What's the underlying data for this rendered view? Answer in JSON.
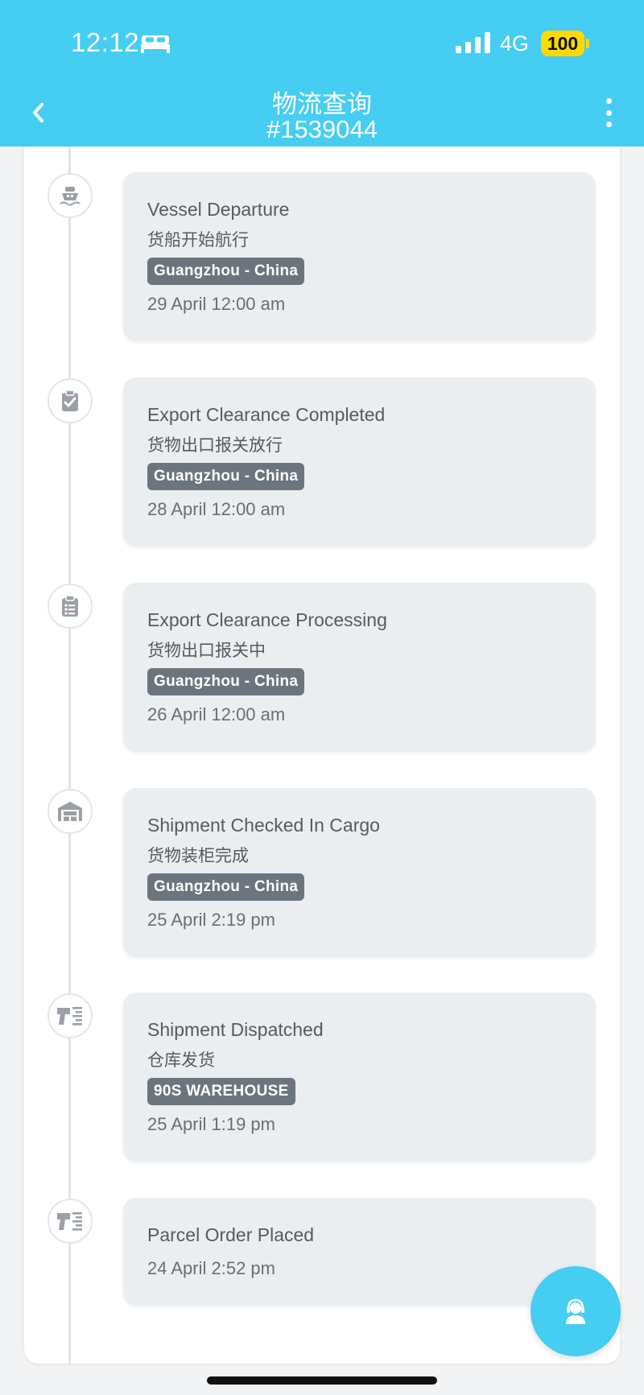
{
  "status_bar": {
    "time": "12:12",
    "network": "4G",
    "battery": "100"
  },
  "header": {
    "title": "物流查询",
    "order_number": "#1539044"
  },
  "events": [
    {
      "title": "Vessel Departure",
      "subtitle": "货船开始航行",
      "location": "Guangzhou - China",
      "datetime": "29 April 12:00 am",
      "icon": "ship-icon"
    },
    {
      "title": "Export Clearance Completed",
      "subtitle": "货物出口报关放行",
      "location": "Guangzhou - China",
      "datetime": "28 April 12:00 am",
      "icon": "clipboard-check-icon"
    },
    {
      "title": "Export Clearance Processing",
      "subtitle": "货物出口报关中",
      "location": "Guangzhou - China",
      "datetime": "26 April 12:00 am",
      "icon": "clipboard-list-icon"
    },
    {
      "title": "Shipment Checked In Cargo",
      "subtitle": "货物装柜完成",
      "location": "Guangzhou - China",
      "datetime": "25 April 2:19 pm",
      "icon": "warehouse-icon"
    },
    {
      "title": "Shipment Dispatched",
      "subtitle": "仓库发货",
      "location": "90S WAREHOUSE",
      "datetime": "25 April 1:19 pm",
      "icon": "barcode-scanner-icon"
    },
    {
      "title": "Parcel Order Placed",
      "datetime": "24 April 2:52 pm",
      "icon": "barcode-scanner-icon"
    }
  ],
  "colors": {
    "accent": "#45cdf2",
    "badge": "#6c757d",
    "card": "#ebeef0",
    "battery": "#ffd900"
  }
}
